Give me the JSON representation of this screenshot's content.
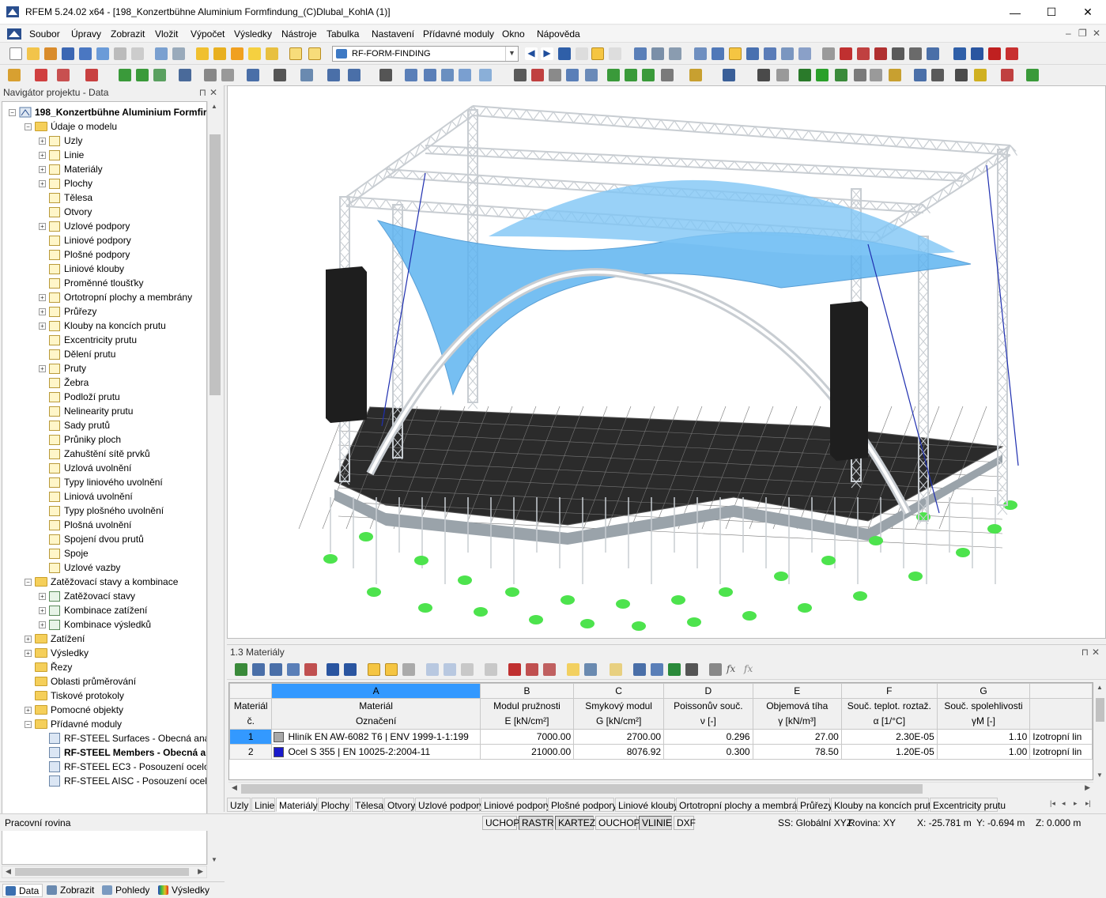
{
  "window": {
    "title": "RFEM 5.24.02 x64 - [198_Konzertbühne Aluminium Formfindung_(C)Dlubal_KohlA (1)]",
    "minimize": "—",
    "maximize": "☐",
    "close": "✕"
  },
  "menu": [
    "Soubor",
    "Úpravy",
    "Zobrazit",
    "Vložit",
    "Výpočet",
    "Výsledky",
    "Nástroje",
    "Tabulka",
    "Nastavení",
    "Přídavné moduly",
    "Okno",
    "Nápověda"
  ],
  "mdi_controls": {
    "minimize": "–",
    "restore": "❐",
    "close": "✕"
  },
  "toolbar": {
    "analysis_combo": "RF-FORM-FINDING"
  },
  "navigator": {
    "title": "Navigátor projektu - Data",
    "pin": "⊓",
    "close": "✕",
    "root": "198_Konzertbühne Aluminium Formfir",
    "items": [
      {
        "label": "Údaje o modelu",
        "level": 1,
        "type": "folder",
        "exp": "−"
      },
      {
        "label": "Uzly",
        "level": 2,
        "type": "doc",
        "exp": "+"
      },
      {
        "label": "Linie",
        "level": 2,
        "type": "doc",
        "exp": "+"
      },
      {
        "label": "Materiály",
        "level": 2,
        "type": "doc",
        "exp": "+"
      },
      {
        "label": "Plochy",
        "level": 2,
        "type": "doc",
        "exp": "+"
      },
      {
        "label": "Tělesa",
        "level": 2,
        "type": "doc",
        "exp": ""
      },
      {
        "label": "Otvory",
        "level": 2,
        "type": "doc",
        "exp": ""
      },
      {
        "label": "Uzlové podpory",
        "level": 2,
        "type": "doc",
        "exp": "+"
      },
      {
        "label": "Liniové podpory",
        "level": 2,
        "type": "doc",
        "exp": ""
      },
      {
        "label": "Plošné podpory",
        "level": 2,
        "type": "doc",
        "exp": ""
      },
      {
        "label": "Liniové klouby",
        "level": 2,
        "type": "doc",
        "exp": ""
      },
      {
        "label": "Proměnné tloušťky",
        "level": 2,
        "type": "doc",
        "exp": ""
      },
      {
        "label": "Ortotropní plochy a membrány",
        "level": 2,
        "type": "doc",
        "exp": "+"
      },
      {
        "label": "Průřezy",
        "level": 2,
        "type": "doc",
        "exp": "+"
      },
      {
        "label": "Klouby na koncích prutu",
        "level": 2,
        "type": "doc",
        "exp": "+"
      },
      {
        "label": "Excentricity prutu",
        "level": 2,
        "type": "doc",
        "exp": ""
      },
      {
        "label": "Dělení prutu",
        "level": 2,
        "type": "doc",
        "exp": ""
      },
      {
        "label": "Pruty",
        "level": 2,
        "type": "doc",
        "exp": "+"
      },
      {
        "label": "Žebra",
        "level": 2,
        "type": "doc",
        "exp": ""
      },
      {
        "label": "Podloží prutu",
        "level": 2,
        "type": "doc",
        "exp": ""
      },
      {
        "label": "Nelinearity prutu",
        "level": 2,
        "type": "doc",
        "exp": ""
      },
      {
        "label": "Sady prutů",
        "level": 2,
        "type": "doc",
        "exp": ""
      },
      {
        "label": "Průniky ploch",
        "level": 2,
        "type": "doc",
        "exp": ""
      },
      {
        "label": "Zahuštění sítě prvků",
        "level": 2,
        "type": "doc",
        "exp": ""
      },
      {
        "label": "Uzlová uvolnění",
        "level": 2,
        "type": "doc",
        "exp": ""
      },
      {
        "label": "Typy liniového uvolnění",
        "level": 2,
        "type": "doc",
        "exp": ""
      },
      {
        "label": "Liniová uvolnění",
        "level": 2,
        "type": "doc",
        "exp": ""
      },
      {
        "label": "Typy plošného uvolnění",
        "level": 2,
        "type": "doc",
        "exp": ""
      },
      {
        "label": "Plošná uvolnění",
        "level": 2,
        "type": "doc",
        "exp": ""
      },
      {
        "label": "Spojení dvou prutů",
        "level": 2,
        "type": "doc",
        "exp": ""
      },
      {
        "label": "Spoje",
        "level": 2,
        "type": "doc",
        "exp": ""
      },
      {
        "label": "Uzlové vazby",
        "level": 2,
        "type": "doc",
        "exp": ""
      },
      {
        "label": "Zatěžovací stavy a kombinace",
        "level": 1,
        "type": "folder",
        "exp": "−"
      },
      {
        "label": "Zatěžovací stavy",
        "level": 2,
        "type": "lc",
        "exp": "+"
      },
      {
        "label": "Kombinace zatížení",
        "level": 2,
        "type": "lc",
        "exp": "+"
      },
      {
        "label": "Kombinace výsledků",
        "level": 2,
        "type": "lc",
        "exp": "+"
      },
      {
        "label": "Zatížení",
        "level": 1,
        "type": "folder",
        "exp": "+"
      },
      {
        "label": "Výsledky",
        "level": 1,
        "type": "folder",
        "exp": "+"
      },
      {
        "label": "Řezy",
        "level": 1,
        "type": "folder",
        "exp": ""
      },
      {
        "label": "Oblasti průměrování",
        "level": 1,
        "type": "folder",
        "exp": ""
      },
      {
        "label": "Tiskové protokoly",
        "level": 1,
        "type": "folder",
        "exp": ""
      },
      {
        "label": "Pomocné objekty",
        "level": 1,
        "type": "folder",
        "exp": "+"
      },
      {
        "label": "Přídavné moduly",
        "level": 1,
        "type": "folder",
        "exp": "−"
      },
      {
        "label": "RF-STEEL Surfaces - Obecná analy",
        "level": 2,
        "type": "mod",
        "exp": ""
      },
      {
        "label": "RF-STEEL Members - Obecná an",
        "level": 2,
        "type": "mod",
        "exp": "",
        "bold": true
      },
      {
        "label": "RF-STEEL EC3 - Posouzení ocelov",
        "level": 2,
        "type": "mod",
        "exp": ""
      },
      {
        "label": "RF-STEEL AISC - Posouzení ocelov",
        "level": 2,
        "type": "mod",
        "exp": ""
      }
    ],
    "tabs": [
      "Data",
      "Zobrazit",
      "Pohledy",
      "Výsledky"
    ]
  },
  "table_panel": {
    "title": "1.3 Materiály",
    "pin": "⊓",
    "close": "✕",
    "col_letters": [
      "A",
      "B",
      "C",
      "D",
      "E",
      "F",
      "G",
      ""
    ],
    "row_header": [
      "Materiál",
      "č."
    ],
    "headers_top": [
      "Materiál",
      "Modul pružnosti",
      "Smykový modul",
      "Poissonův souč.",
      "Objemová tíha",
      "Souč. teplot. roztaž.",
      "Souč. spolehlivosti",
      ""
    ],
    "headers_bottom": [
      "Označení",
      "E [kN/cm²]",
      "G [kN/cm²]",
      "ν [-]",
      "γ [kN/m³]",
      "α [1/°C]",
      "γM [-]",
      ""
    ],
    "rows": [
      {
        "no": "1",
        "swatch": "#a9a9a9",
        "name": "Hliník EN AW-6082 T6 | ENV 1999-1-1:199",
        "E": "7000.00",
        "G": "2700.00",
        "nu": "0.296",
        "gamma": "27.00",
        "alpha": "2.30E-05",
        "gm": "1.10",
        "model": "Izotropní lin"
      },
      {
        "no": "2",
        "swatch": "#1a1acc",
        "name": "Ocel S 355 | EN 10025-2:2004-11",
        "E": "21000.00",
        "G": "8076.92",
        "nu": "0.300",
        "gamma": "78.50",
        "alpha": "1.20E-05",
        "gm": "1.00",
        "model": "Izotropní lin"
      }
    ],
    "sheet_tabs": [
      "Uzly",
      "Linie",
      "Materiály",
      "Plochy",
      "Tělesa",
      "Otvory",
      "Uzlové podpory",
      "Liniové podpory",
      "Plošné podpory",
      "Liniové klouby",
      "Ortotropní plochy a membrány",
      "Průřezy",
      "Klouby na koncích prutu",
      "Excentricity prutu"
    ],
    "active_tab": "Materiály",
    "nav_arrows": [
      "|◂",
      "◂",
      "▸",
      "▸|"
    ]
  },
  "statusbar": {
    "left": "Pracovní rovina",
    "toggles": [
      {
        "label": "UCHOP",
        "on": false
      },
      {
        "label": "RASTR",
        "on": true
      },
      {
        "label": "KARTEZ",
        "on": true
      },
      {
        "label": "OUCHOP",
        "on": false
      },
      {
        "label": "VLINIE",
        "on": true
      },
      {
        "label": "DXF",
        "on": false
      }
    ],
    "cs": "SS: Globální XYZ",
    "plane": "Rovina: XY",
    "x": "X: -25.781 m",
    "y": "Y: -0.694 m",
    "z": "Z: 0.000 m"
  },
  "colors": {
    "membrane": "#5fb4f0",
    "truss": "#c8cdd2",
    "deck": "#2b2b2b",
    "support": "#4de34d",
    "speaker": "#1e1e1e",
    "cable": "#1f2fb0"
  }
}
